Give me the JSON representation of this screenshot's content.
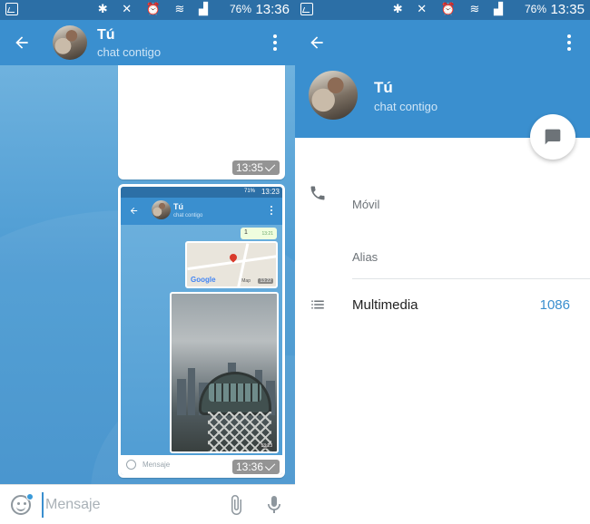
{
  "status_bar": {
    "battery": "76%",
    "time_left": "13:36",
    "time_right": "13:35"
  },
  "chat": {
    "header": {
      "title": "Tú",
      "subtitle": "chat contigo"
    },
    "messages": [
      {
        "type": "blank",
        "time": "13:35"
      },
      {
        "type": "screenshot",
        "time": "13:36"
      }
    ],
    "input": {
      "placeholder": "Mensaje"
    },
    "icons": {
      "back": "back-arrow-icon",
      "menu": "more-vertical-icon",
      "emoji": "emoji-icon",
      "attach": "paperclip-icon",
      "mic": "microphone-icon"
    }
  },
  "mini_screenshot": {
    "status_battery": "71%",
    "status_time": "13:23",
    "title": "Tú",
    "subtitle": "chat contigo",
    "msg_text": "1",
    "msg_time": "13:21",
    "map_brand": "Google",
    "map_data_label": "Map",
    "map_time": "13:22",
    "photo_time": "13:23",
    "input_placeholder": "Mensaje"
  },
  "profile": {
    "header": {
      "title": "Tú",
      "subtitle": "chat contigo"
    },
    "rows": {
      "phone_label": "Móvil",
      "alias_label": "Alias"
    },
    "media": {
      "label": "Multimedia",
      "count": "1086"
    },
    "colors": {
      "primary": "#3a8fcf",
      "status": "#2c6fa6"
    }
  }
}
